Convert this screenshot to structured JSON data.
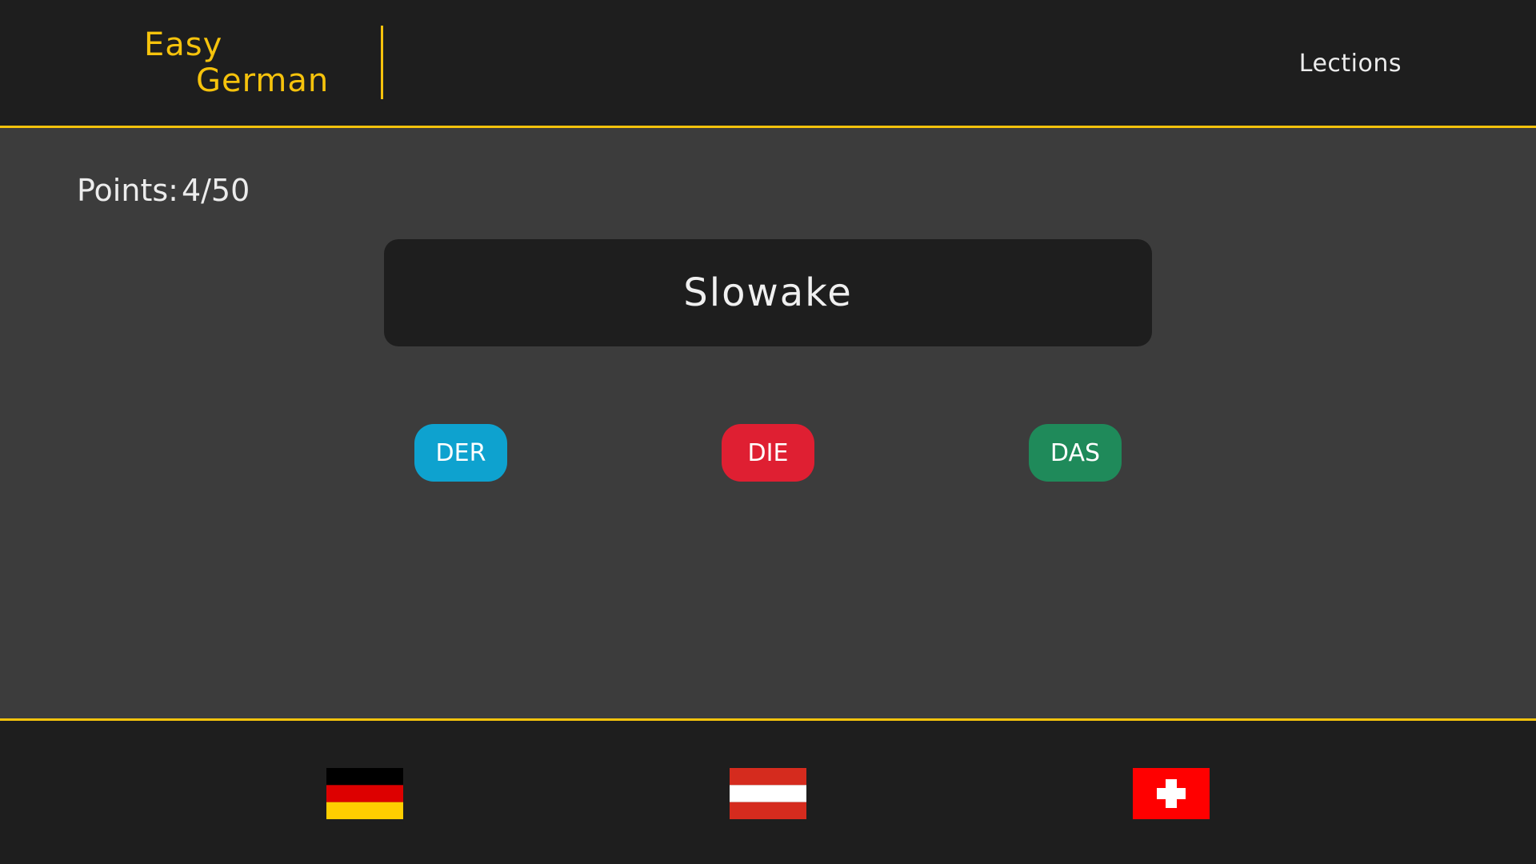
{
  "header": {
    "logo_line1": "Easy",
    "logo_line2": "German",
    "nav_lections": "Lections"
  },
  "quiz": {
    "points_label": "Points:",
    "points_value": "4/50",
    "word": "Slowake",
    "articles": [
      {
        "label": "DER",
        "color": "#0ea2cf"
      },
      {
        "label": "DIE",
        "color": "#df1f32"
      },
      {
        "label": "DAS",
        "color": "#1f8a5a"
      }
    ]
  },
  "footer": {
    "flags": [
      {
        "icon": "germany-flag-icon",
        "colors": [
          "#000000",
          "#dd0000",
          "#ffce00"
        ]
      },
      {
        "icon": "austria-flag-icon",
        "colors": [
          "#ed2939",
          "#ffffff",
          "#ed2939"
        ]
      },
      {
        "icon": "switzerland-flag-icon",
        "colors": [
          "#ff0000",
          "#ffffff"
        ]
      }
    ]
  },
  "colors": {
    "accent": "#f6c30c",
    "background": "#3c3c3c",
    "bar": "#1e1e1e"
  }
}
